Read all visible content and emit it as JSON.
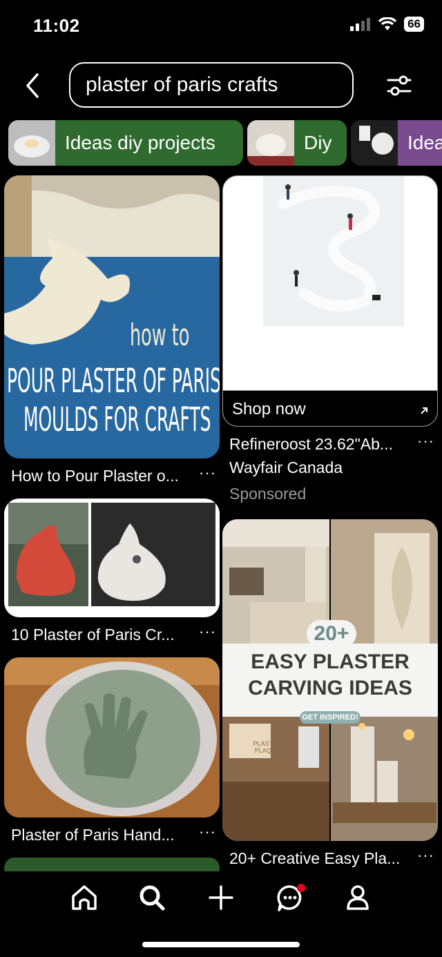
{
  "status_bar": {
    "time": "11:02",
    "battery": "66"
  },
  "search": {
    "query": "plaster of paris crafts"
  },
  "chips": [
    {
      "label": "Ideas diy projects",
      "color": "#2f6b2f"
    },
    {
      "label": "Diy",
      "color": "#2f6b2f"
    },
    {
      "label": "Idea",
      "color": "#7a4a8f"
    }
  ],
  "pins_left": [
    {
      "overlay_line1": "how to",
      "overlay_line2": "POUR PLASTER OF PARIS",
      "overlay_line3": "MOULDS FOR CRAFTS",
      "title": "How to Pour Plaster o..."
    },
    {
      "title": "10 Plaster of Paris Cr..."
    },
    {
      "title": "Plaster of Paris Hand..."
    }
  ],
  "pins_right": [
    {
      "cta": "Shop now",
      "title": "Refineroost 23.62\"Ab...",
      "merchant": "Wayfair Canada",
      "sponsored": "Sponsored"
    },
    {
      "badge": "20+",
      "headline1": "EASY PLASTER",
      "headline2": "CARVING IDEAS",
      "tag": "GET INSPIRED!",
      "plaque": "PLASTER PLAQUE",
      "title": "20+ Creative Easy Pla..."
    }
  ],
  "more_label": "···",
  "colors": {
    "background": "#000000",
    "notification_dot": "#e60023",
    "chip_green": "#2f6b2f",
    "chip_purple": "#7a4a8f"
  },
  "icons": [
    "back-chevron-icon",
    "filter-sliders-icon",
    "home-icon",
    "search-icon",
    "create-plus-icon",
    "messages-icon",
    "profile-icon"
  ]
}
